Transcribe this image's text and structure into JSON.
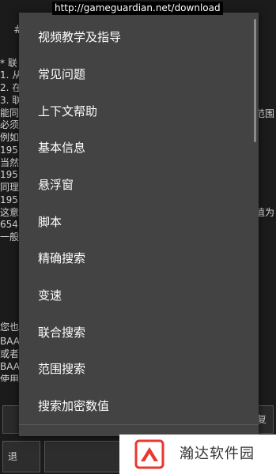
{
  "watermark_url": "http://gameguardian.net/download",
  "background": {
    "left_fragments": [
      "#",
      "* 联",
      "1. 从",
      "2. 在",
      "3. 联",
      "能同",
      "必须",
      "例如",
      "195",
      "当然",
      "195",
      "同理",
      "195",
      "这意",
      "654",
      "一般",
      "您也",
      "BAA",
      "或者",
      "BAA",
      "使用"
    ],
    "right_fragments": [
      "范围",
      "值为"
    ],
    "input_button_label": "复",
    "exit_button_label": "退"
  },
  "menu": {
    "items": [
      {
        "label": "视频教学及指导"
      },
      {
        "label": "常见问题"
      },
      {
        "label": "上下文帮助"
      },
      {
        "label": "基本信息"
      },
      {
        "label": "悬浮窗"
      },
      {
        "label": "脚本"
      },
      {
        "label": "精确搜索"
      },
      {
        "label": "变速"
      },
      {
        "label": "联合搜索"
      },
      {
        "label": "范围搜索"
      },
      {
        "label": "搜索加密数值"
      }
    ]
  },
  "brand_watermark": {
    "text": "瀚达软件园",
    "logo_color": "#e8382f"
  }
}
